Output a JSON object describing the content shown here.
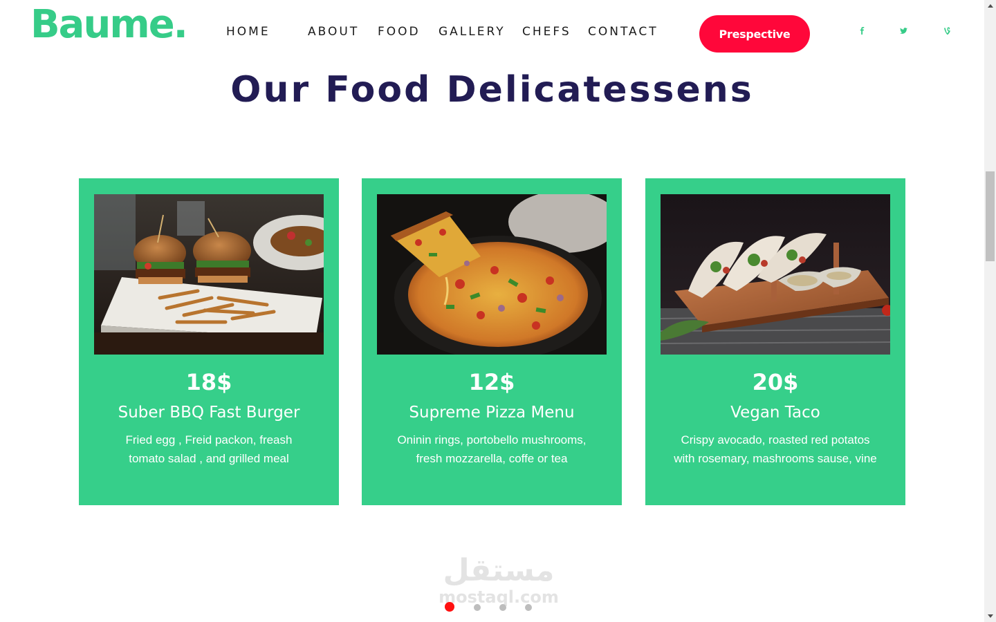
{
  "brand": {
    "logo": "Baume."
  },
  "nav": {
    "items": [
      {
        "label": "HOME"
      },
      {
        "label": "ABOUT"
      },
      {
        "label": "FOOD"
      },
      {
        "label": "GALLERY"
      },
      {
        "label": "CHEFS"
      },
      {
        "label": "CONTACT"
      }
    ],
    "cta_label": "Prespective"
  },
  "social": [
    {
      "icon": "facebook-icon"
    },
    {
      "icon": "twitter-icon"
    },
    {
      "icon": "vine-icon"
    }
  ],
  "section": {
    "title": "Our Food Delicatessens"
  },
  "cards": [
    {
      "price": "18$",
      "title": "Suber BBQ Fast Burger",
      "desc_line1": "Fried egg , Freid packon, freash",
      "desc_line2": "tomato salad , and grilled meal",
      "image": "burger-photo"
    },
    {
      "price": "12$",
      "title": "Supreme Pizza Menu",
      "desc_line1": "Oninin rings, portobello mushrooms,",
      "desc_line2": "fresh mozzarella, coffe or tea",
      "image": "pizza-photo"
    },
    {
      "price": "20$",
      "title": "Vegan Taco",
      "desc_line1": "Crispy avocado, roasted red potatos",
      "desc_line2": "with rosemary, mashrooms sause, vine",
      "image": "taco-photo"
    }
  ],
  "carousel": {
    "total": 4,
    "active": 1
  },
  "watermark": {
    "arabic": "مستقل",
    "latin": "mostaql.com"
  },
  "colors": {
    "brand_green": "#36cc88",
    "card_green": "#36cf8a",
    "cta_red": "#ff073a",
    "title_navy": "#221c54",
    "dot_active": "#ff1010"
  }
}
